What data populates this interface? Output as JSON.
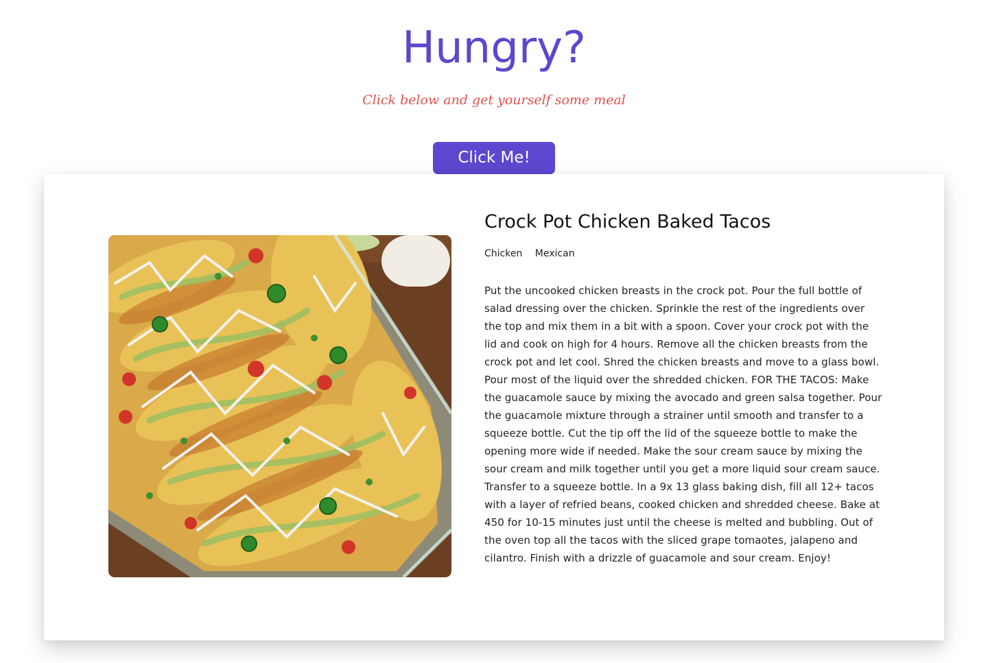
{
  "header": {
    "title": "Hungry?",
    "subtitle": "Click below and get yourself some meal",
    "button_label": "Click Me!"
  },
  "colors": {
    "accent": "#5b48cf",
    "subtitle": "#e0524f"
  },
  "meal": {
    "name": "Crock Pot Chicken Baked Tacos",
    "tags": [
      "Chicken",
      "Mexican"
    ],
    "instructions": "Put the uncooked chicken breasts in the crock pot. Pour the full bottle of salad dressing over the chicken. Sprinkle the rest of the ingredients over the top and mix them in a bit with a spoon. Cover your crock pot with the lid and cook on high for 4 hours. Remove all the chicken breasts from the crock pot and let cool. Shred the chicken breasts and move to a glass bowl. Pour most of the liquid over the shredded chicken. FOR THE TACOS: Make the guacamole sauce by mixing the avocado and green salsa together. Pour the guacamole mixture through a strainer until smooth and transfer to a squeeze bottle. Cut the tip off the lid of the squeeze bottle to make the opening more wide if needed. Make the sour cream sauce by mixing the sour cream and milk together until you get a more liquid sour cream sauce. Transfer to a squeeze bottle. In a 9x 13 glass baking dish, fill all 12+ tacos with a layer of refried beans, cooked chicken and shredded cheese. Bake at 450 for 10-15 minutes just until the cheese is melted and bubbling. Out of the oven top all the tacos with the sliced grape tomaotes, jalapeno and cilantro. Finish with a drizzle of guacamole and sour cream. Enjoy!"
  }
}
